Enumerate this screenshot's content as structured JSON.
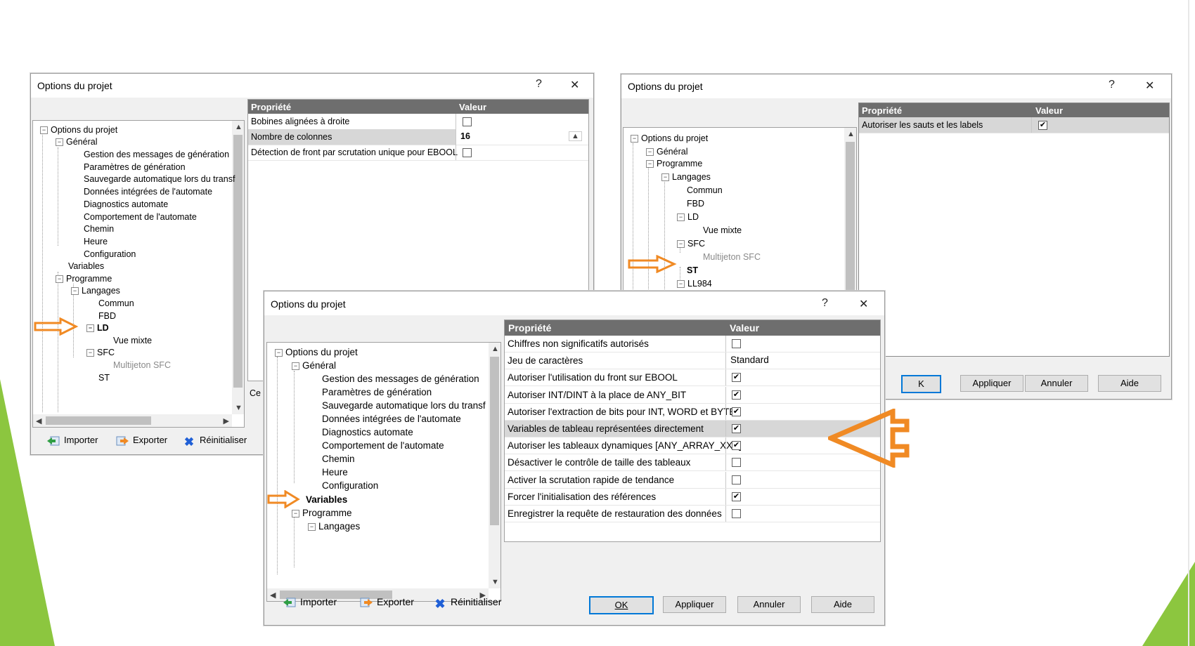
{
  "accent": "#f08a24",
  "deco_green": "#8cc63f",
  "dialog1": {
    "title": "Options du projet",
    "help": "?",
    "close": "✕",
    "tree": [
      "Options du projet",
      "Général",
      "Gestion des messages de génération",
      "Paramètres de génération",
      "Sauvegarde automatique lors du transf",
      "Données intégrées de l'automate",
      "Diagnostics automate",
      "Comportement de l'automate",
      "Chemin",
      "Heure",
      "Configuration",
      "Variables",
      "Programme",
      "Langages",
      "Commun",
      "FBD",
      "LD",
      "Vue mixte",
      "SFC",
      "Multijeton SFC",
      "ST"
    ],
    "header": {
      "prop": "Propriété",
      "val": "Valeur"
    },
    "rows": [
      {
        "prop": "Bobines alignées à droite",
        "val": "",
        "checked": false
      },
      {
        "prop": "Nombre de colonnes",
        "val": "16"
      },
      {
        "prop": "Détection de front par scrutation unique pour EBOOL",
        "val": "",
        "checked": false
      }
    ],
    "partial": "Ce p",
    "toolbar": {
      "import": "Importer",
      "export": "Exporter",
      "reset": "Réinitialiser"
    }
  },
  "dialog2": {
    "title": "Options du projet",
    "help": "?",
    "close": "✕",
    "tree": [
      "Options du projet",
      "Général",
      "Programme",
      "Langages",
      "Commun",
      "FBD",
      "LD",
      "Vue mixte",
      "SFC",
      "Multijeton SFC",
      "ST",
      "LL984"
    ],
    "header": {
      "prop": "Propriété",
      "val": "Valeur"
    },
    "rows": [
      {
        "prop": "Autoriser les sauts et les labels",
        "checked": true
      }
    ],
    "buttons": {
      "ok": "K",
      "apply": "Appliquer",
      "cancel": "Annuler",
      "help": "Aide"
    }
  },
  "dialog3": {
    "title": "Options du projet",
    "help": "?",
    "close": "✕",
    "tree": [
      "Options du projet",
      "Général",
      "Gestion des messages de génération",
      "Paramètres de génération",
      "Sauvegarde automatique lors du transf",
      "Données intégrées de l'automate",
      "Diagnostics automate",
      "Comportement de l'automate",
      "Chemin",
      "Heure",
      "Configuration",
      "Variables",
      "Programme",
      "Langages"
    ],
    "header": {
      "prop": "Propriété",
      "val": "Valeur"
    },
    "rows": [
      {
        "prop": "Chiffres non significatifs autorisés",
        "checked": false
      },
      {
        "prop": "Jeu de caractères",
        "val": "Standard"
      },
      {
        "prop": "Autoriser l'utilisation du front sur EBOOL",
        "checked": true
      },
      {
        "prop": "Autoriser INT/DINT à la place de ANY_BIT",
        "checked": true
      },
      {
        "prop": "Autoriser l'extraction de bits pour INT, WORD et BYTE",
        "checked": true
      },
      {
        "prop": "Variables de tableau représentées directement",
        "checked": true
      },
      {
        "prop": "Autoriser les tableaux dynamiques [ANY_ARRAY_XXX]",
        "checked": true
      },
      {
        "prop": "Désactiver le contrôle de taille des tableaux",
        "checked": false
      },
      {
        "prop": "Activer la scrutation rapide de tendance",
        "checked": false
      },
      {
        "prop": "Forcer l'initialisation des références",
        "checked": true
      },
      {
        "prop": "Enregistrer la requête de restauration des données",
        "checked": false
      }
    ],
    "toolbar": {
      "import": "Importer",
      "export": "Exporter",
      "reset": "Réinitialiser"
    },
    "buttons": {
      "ok": "OK",
      "apply": "Appliquer",
      "cancel": "Annuler",
      "help": "Aide"
    }
  }
}
